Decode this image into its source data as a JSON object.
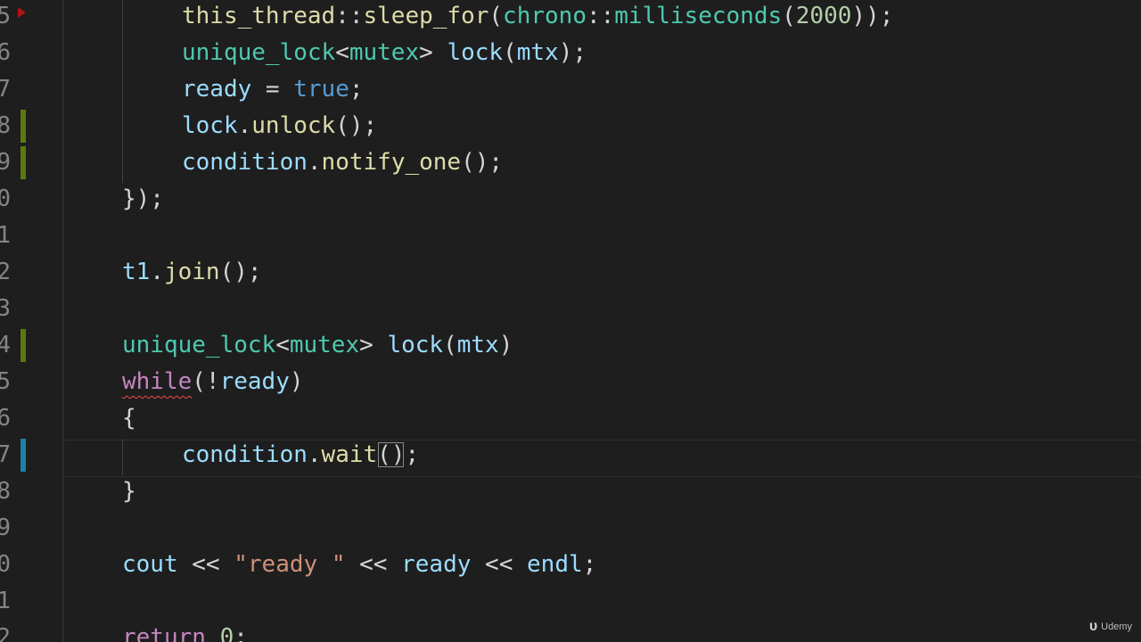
{
  "editor": {
    "lines": [
      {
        "num": "5",
        "tokens": [
          {
            "c": "fn",
            "t": "this_thread"
          },
          {
            "c": "pl",
            "t": "::"
          },
          {
            "c": "fn",
            "t": "sleep_for"
          },
          {
            "c": "pl",
            "t": "("
          },
          {
            "c": "ty",
            "t": "chrono"
          },
          {
            "c": "pl",
            "t": "::"
          },
          {
            "c": "ty",
            "t": "milliseconds"
          },
          {
            "c": "pl",
            "t": "("
          },
          {
            "c": "num",
            "t": "2000"
          },
          {
            "c": "pl",
            "t": "));"
          }
        ]
      },
      {
        "num": "6",
        "tokens": [
          {
            "c": "ty",
            "t": "unique_lock"
          },
          {
            "c": "pl",
            "t": "<"
          },
          {
            "c": "ty",
            "t": "mutex"
          },
          {
            "c": "pl",
            "t": "> "
          },
          {
            "c": "var",
            "t": "lock"
          },
          {
            "c": "pl",
            "t": "("
          },
          {
            "c": "var",
            "t": "mtx"
          },
          {
            "c": "pl",
            "t": ");"
          }
        ]
      },
      {
        "num": "7",
        "tokens": [
          {
            "c": "var",
            "t": "ready"
          },
          {
            "c": "pl",
            "t": " = "
          },
          {
            "c": "kw",
            "t": "true"
          },
          {
            "c": "pl",
            "t": ";"
          }
        ]
      },
      {
        "num": "8",
        "tokens": [
          {
            "c": "var",
            "t": "lock"
          },
          {
            "c": "pl",
            "t": "."
          },
          {
            "c": "fn",
            "t": "unlock"
          },
          {
            "c": "pl",
            "t": "();"
          }
        ]
      },
      {
        "num": "9",
        "tokens": [
          {
            "c": "var",
            "t": "condition"
          },
          {
            "c": "pl",
            "t": "."
          },
          {
            "c": "fn",
            "t": "notify_one"
          },
          {
            "c": "pl",
            "t": "();"
          }
        ]
      },
      {
        "num": "0",
        "tokens": [
          {
            "c": "pl",
            "t": "});"
          }
        ]
      },
      {
        "num": "1",
        "tokens": []
      },
      {
        "num": "2",
        "tokens": [
          {
            "c": "var",
            "t": "t1"
          },
          {
            "c": "pl",
            "t": "."
          },
          {
            "c": "fn",
            "t": "join"
          },
          {
            "c": "pl",
            "t": "();"
          }
        ]
      },
      {
        "num": "3",
        "tokens": []
      },
      {
        "num": "4",
        "tokens": [
          {
            "c": "ty",
            "t": "unique_lock"
          },
          {
            "c": "pl",
            "t": "<"
          },
          {
            "c": "ty",
            "t": "mutex"
          },
          {
            "c": "pl",
            "t": "> "
          },
          {
            "c": "var",
            "t": "lock"
          },
          {
            "c": "pl",
            "t": "("
          },
          {
            "c": "var",
            "t": "mtx"
          },
          {
            "c": "pl",
            "t": ")"
          }
        ]
      },
      {
        "num": "5",
        "tokens": [
          {
            "c": "ctrl",
            "t": "while",
            "squiggle": true
          },
          {
            "c": "pl",
            "t": "(!"
          },
          {
            "c": "var",
            "t": "ready"
          },
          {
            "c": "pl",
            "t": ")"
          }
        ]
      },
      {
        "num": "6",
        "tokens": [
          {
            "c": "pl",
            "t": "{"
          }
        ]
      },
      {
        "num": "7",
        "tokens": [
          {
            "c": "var",
            "t": "condition"
          },
          {
            "c": "pl",
            "t": "."
          },
          {
            "c": "fn",
            "t": "wait"
          },
          {
            "c": "pl",
            "t": "()",
            "match": true
          },
          {
            "c": "pl",
            "t": ";"
          }
        ]
      },
      {
        "num": "8",
        "tokens": [
          {
            "c": "pl",
            "t": "}"
          }
        ]
      },
      {
        "num": "9",
        "tokens": []
      },
      {
        "num": "0",
        "tokens": [
          {
            "c": "var",
            "t": "cout"
          },
          {
            "c": "pl",
            "t": " << "
          },
          {
            "c": "str",
            "t": "\"ready \""
          },
          {
            "c": "pl",
            "t": " << "
          },
          {
            "c": "var",
            "t": "ready"
          },
          {
            "c": "pl",
            "t": " << "
          },
          {
            "c": "var",
            "t": "endl"
          },
          {
            "c": "pl",
            "t": ";"
          }
        ]
      },
      {
        "num": "1",
        "tokens": []
      },
      {
        "num": "2",
        "tokens": [
          {
            "c": "ctrl",
            "t": "return"
          },
          {
            "c": "pl",
            "t": " "
          },
          {
            "c": "num",
            "t": "0"
          },
          {
            "c": "pl",
            "t": ";"
          }
        ]
      }
    ]
  },
  "watermark": {
    "logo": "υ",
    "text": "Udemy"
  },
  "colors": {
    "background": "#1e1e1e",
    "git_added": "#587c0c",
    "git_modified": "#1b81a8",
    "error_squiggle": "#f14c4c"
  }
}
